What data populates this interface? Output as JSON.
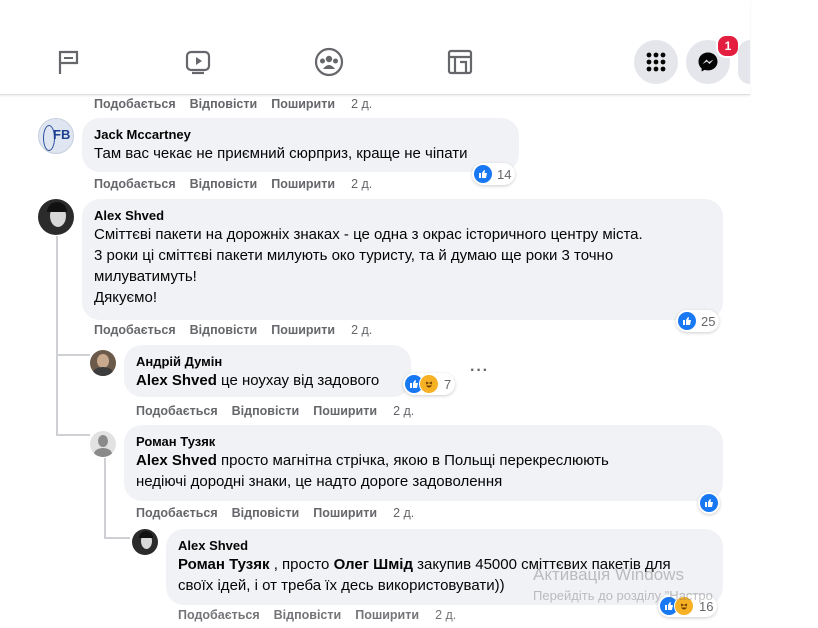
{
  "nav": {
    "icons": [
      "flag-icon",
      "video-play-icon",
      "groups-icon",
      "gaming-icon"
    ],
    "messenger_badge": "1"
  },
  "actions": {
    "like": "Подобається",
    "reply": "Відповісти",
    "share": "Поширити"
  },
  "top_partial": {
    "time": "2 д."
  },
  "comments": [
    {
      "author": "Jack Mccartney",
      "avatar_text": "FB",
      "text": "Там вас чекає не приємний сюрприз, краще не чіпати",
      "time": "2 д.",
      "reactions": "14"
    },
    {
      "author": "Alex Shved",
      "text_lines": [
        "Сміттєві пакети на дорожніх знаках - це одна з окрас історичного центру міста.",
        "3 роки ці сміттєві пакети милують око туристу, та й думаю ще роки 3 точно",
        "милуватимуть!",
        "Дякуємо!"
      ],
      "time": "2 д.",
      "reactions": "25"
    },
    {
      "author": "Андрій Думін",
      "mention": "Alex Shved",
      "text": " це ноухау від задового",
      "time": "2 д.",
      "reactions": "7"
    },
    {
      "author": "Роман Тузяк",
      "mention": "Alex Shved",
      "text_line1": " просто магнітна стрічка, якою в Польщі перекреслюють",
      "text_line2": "недіючі дородні знаки, це надто дороге задоволення",
      "time": "2 д."
    },
    {
      "author": "Alex Shved",
      "mention1": "Роман Тузяк",
      "mid": " , просто ",
      "mention2": "Олег Шмід",
      "text_line1": " закупив 45000 сміттєвих пакетів для",
      "text_line2": "своїх ідей, і от треба їх десь використовувати))",
      "time": "2 д.",
      "reactions": "16"
    }
  ],
  "watermark": {
    "title": "Активація Windows",
    "subtitle": "Перейдіть до розділу \"Настро"
  }
}
